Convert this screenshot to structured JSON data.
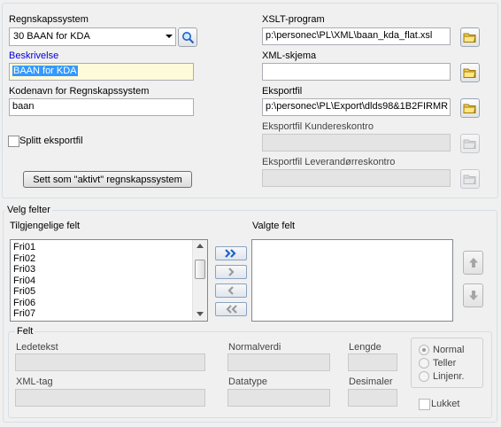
{
  "system": {
    "regnskapssystem_label": "Regnskapssystem",
    "regnskapssystem_value": "30 BAAN for KDA",
    "beskrivelse_label": "Beskrivelse",
    "beskrivelse_value": "BAAN for KDA",
    "kodenavn_label": "Kodenavn for Regnskapssystem",
    "kodenavn_value": "baan",
    "splitt_label": "Splitt eksportfil",
    "splitt_checked": false,
    "set_active_button": "Sett som \"aktivt\" regnskapssystem",
    "xslt_label": "XSLT-program",
    "xslt_value": "p:\\personec\\PL\\XML\\baan_kda_flat.xsl",
    "xml_skjema_label": "XML-skjema",
    "xml_skjema_value": "",
    "eksportfil_label": "Eksportfil",
    "eksportfil_value": "p:\\personec\\PL\\Export\\dlds98&1B2FIRMR",
    "kundereskontro_label": "Eksportfil Kundereskontro",
    "leverandor_label": "Eksportfil Leverandørreskontro"
  },
  "felter": {
    "group_label": "Velg felter",
    "available_label": "Tilgjengelige felt",
    "selected_label": "Valgte felt",
    "available_items": [
      "Fri01",
      "Fri02",
      "Fri03",
      "Fri04",
      "Fri05",
      "Fri06",
      "Fri07"
    ],
    "selected_items": []
  },
  "felt": {
    "group_label": "Felt",
    "ledetekst_label": "Ledetekst",
    "normalverdi_label": "Normalverdi",
    "lengde_label": "Lengde",
    "xmltag_label": "XML-tag",
    "datatype_label": "Datatype",
    "desimaler_label": "Desimaler",
    "radio_options": [
      "Normal",
      "Teller",
      "Linjenr."
    ],
    "radio_selected": "Normal",
    "lukket_label": "Lukket"
  },
  "colors": {
    "accent": "#1e63c8",
    "selection": "#3399ff",
    "highlight_field": "#fffad9"
  }
}
